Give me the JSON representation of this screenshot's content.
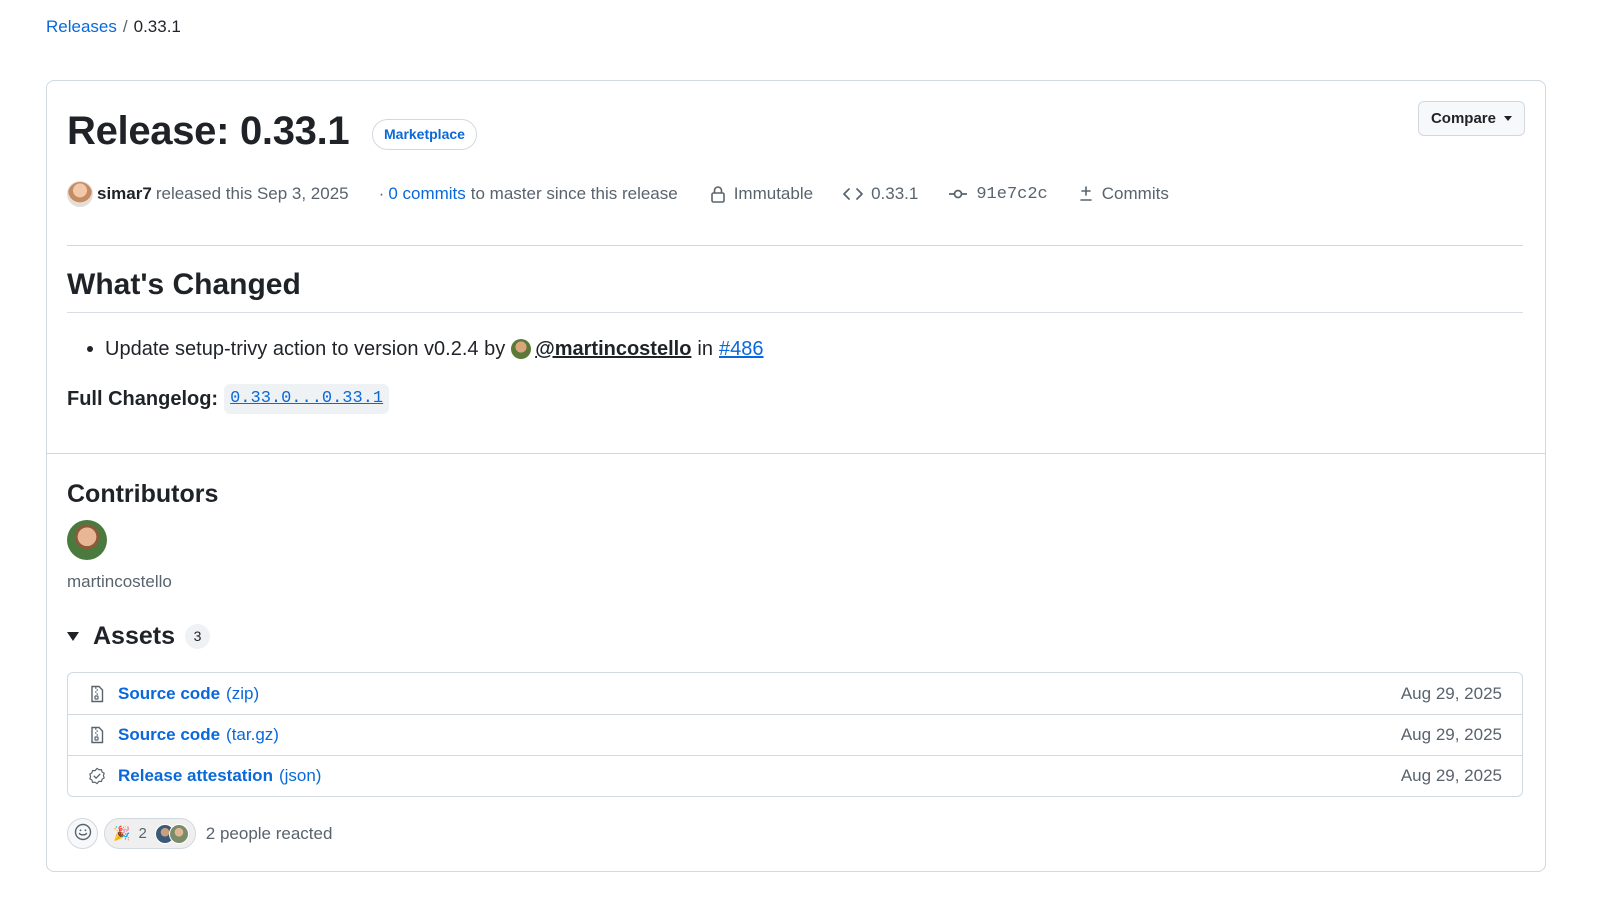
{
  "breadcrumb": {
    "parent": "Releases",
    "separator": "/",
    "current": "0.33.1"
  },
  "release": {
    "title": "Release: 0.33.1",
    "badge": "Marketplace",
    "compare_label": "Compare",
    "author": "simar7",
    "released_text": "released this Sep 3, 2025",
    "commits_prefix": "·",
    "commits_link": "0 commits",
    "commits_suffix": "to master since this release",
    "immutable_label": "Immutable",
    "tag": "0.33.1",
    "commit_sha": "91e7c2c",
    "commits_label": "Commits"
  },
  "changes": {
    "heading": "What's Changed",
    "items": [
      {
        "text": "Update setup-trivy action to version v0.2.4 by",
        "user": "@martincostello",
        "in": "in",
        "pr": "#486"
      }
    ],
    "full_changelog_label": "Full Changelog:",
    "full_changelog_link": "0.33.0...0.33.1"
  },
  "contributors": {
    "heading": "Contributors",
    "names": [
      "martincostello"
    ]
  },
  "assets": {
    "heading": "Assets",
    "count": "3",
    "rows": [
      {
        "name": "Source code",
        "ext": "(zip)",
        "date": "Aug 29, 2025",
        "icon": "file-zip-icon"
      },
      {
        "name": "Source code",
        "ext": "(tar.gz)",
        "date": "Aug 29, 2025",
        "icon": "file-zip-icon"
      },
      {
        "name": "Release attestation",
        "ext": "(json)",
        "date": "Aug 29, 2025",
        "icon": "verified-icon"
      }
    ]
  },
  "reactions": {
    "emoji": "🎉",
    "count": "2",
    "summary": "2 people reacted"
  },
  "colors": {
    "link": "#0969da",
    "text": "#1f2328",
    "muted": "#59636e",
    "border": "#d1d9e0"
  }
}
